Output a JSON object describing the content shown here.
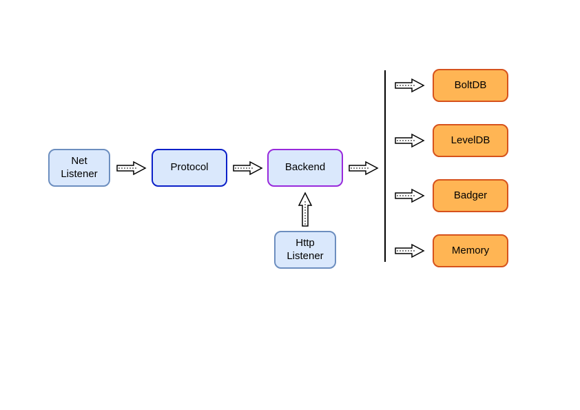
{
  "nodes": {
    "net_listener": {
      "label": "Net\nListener"
    },
    "protocol": {
      "label": "Protocol"
    },
    "backend": {
      "label": "Backend"
    },
    "http_listener": {
      "label": "Http\nListener"
    },
    "boltdb": {
      "label": "BoltDB"
    },
    "leveldb": {
      "label": "LevelDB"
    },
    "badger": {
      "label": "Badger"
    },
    "memory": {
      "label": "Memory"
    }
  },
  "colors": {
    "light_blue_fill": "#dae8fc",
    "light_blue_stroke": "#6c8ebf",
    "protocol_stroke": "#0a1fc8",
    "backend_stroke": "#9829db",
    "orange_fill": "#ffb554",
    "orange_stroke": "#d6521c",
    "arrow_fill": "#ffffff",
    "arrow_stroke": "#000000",
    "divider": "#000000"
  },
  "chart_data": {
    "type": "diagram",
    "title": "",
    "nodes": [
      {
        "id": "net_listener",
        "label": "Net Listener"
      },
      {
        "id": "protocol",
        "label": "Protocol"
      },
      {
        "id": "backend",
        "label": "Backend"
      },
      {
        "id": "http_listener",
        "label": "Http Listener"
      },
      {
        "id": "boltdb",
        "label": "BoltDB"
      },
      {
        "id": "leveldb",
        "label": "LevelDB"
      },
      {
        "id": "badger",
        "label": "Badger"
      },
      {
        "id": "memory",
        "label": "Memory"
      }
    ],
    "edges": [
      {
        "from": "net_listener",
        "to": "protocol"
      },
      {
        "from": "protocol",
        "to": "backend"
      },
      {
        "from": "http_listener",
        "to": "backend"
      },
      {
        "from": "backend",
        "to": "boltdb"
      },
      {
        "from": "backend",
        "to": "leveldb"
      },
      {
        "from": "backend",
        "to": "badger"
      },
      {
        "from": "backend",
        "to": "memory"
      }
    ]
  }
}
